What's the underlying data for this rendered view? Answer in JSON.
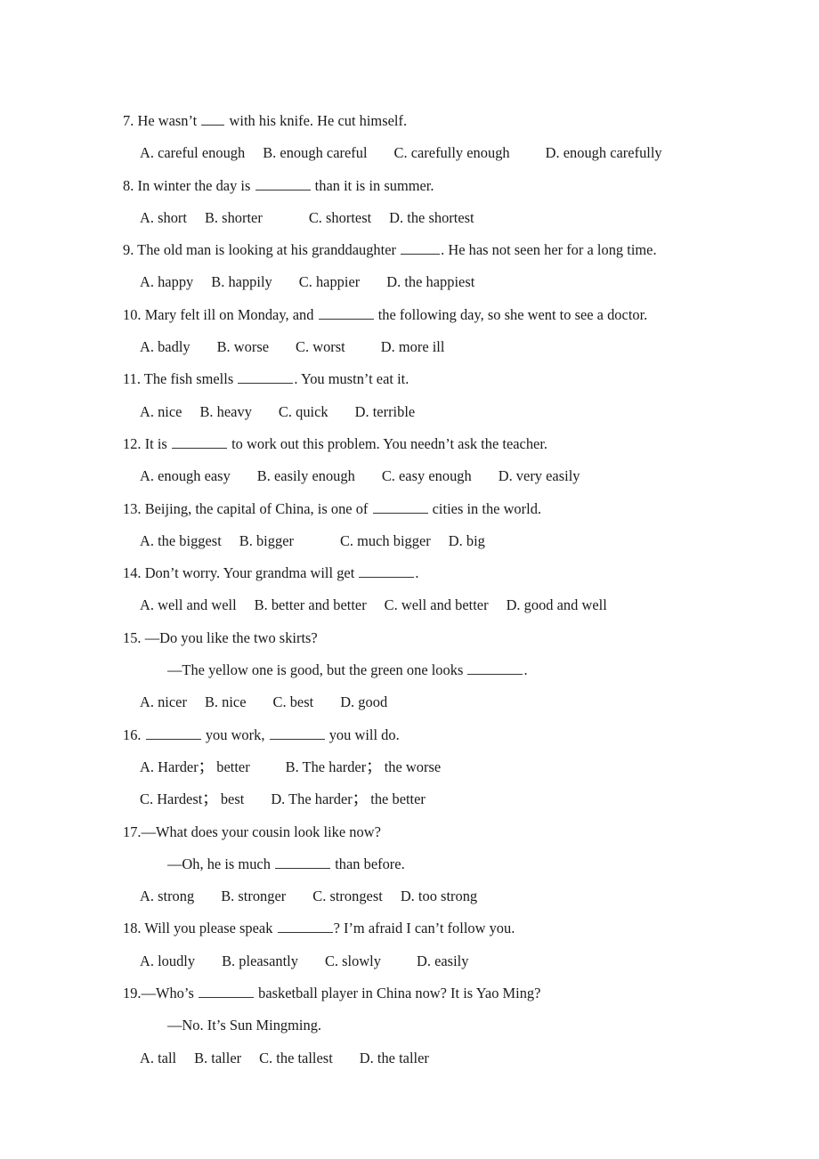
{
  "document": {
    "type": "worksheet",
    "subject": "English grammar multiple-choice exercise",
    "background_color": "#ffffff",
    "text_color": "#1a1a1a"
  },
  "questions": [
    {
      "number": "7.",
      "stem_before": "He wasn’t",
      "blank": "xs",
      "stem_after": "with his knife. He cut himself.",
      "options": [
        "A. careful enough",
        "B. enough careful",
        "C. carefully enough",
        "D. enough carefully"
      ]
    },
    {
      "number": "8.",
      "stem_before": "In winter the day is",
      "blank": "md",
      "stem_after": "than it is in summer.",
      "options": [
        "A. short",
        "B. shorter",
        "C. shortest",
        "D. the shortest"
      ]
    },
    {
      "number": "9.",
      "stem_before": "The old man is looking at his granddaughter",
      "blank": "sm",
      "stem_after": ". He has not seen her for a long time.",
      "options": [
        "A. happy",
        "B. happily",
        "C. happier",
        "D. the happiest"
      ]
    },
    {
      "number": "10.",
      "stem_before": "Mary felt ill on Monday, and",
      "blank": "md",
      "stem_after": "the following day, so she went to see a doctor.",
      "options": [
        "A. badly",
        "B. worse",
        "C. worst",
        "D. more ill"
      ]
    },
    {
      "number": "11.",
      "stem_before": "The fish smells",
      "blank": "md",
      "stem_after": ". You mustn’t eat it.",
      "options": [
        "A. nice",
        "B. heavy",
        "C. quick",
        "D. terrible"
      ]
    },
    {
      "number": "12.",
      "stem_before": "It is",
      "blank": "md",
      "stem_after": "to work out this problem. You needn’t ask the teacher.",
      "options": [
        "A. enough easy",
        "B. easily enough",
        "C. easy enough",
        "D. very easily"
      ]
    },
    {
      "number": "13.",
      "stem_before": "Beijing, the capital of China, is one of",
      "blank": "md",
      "stem_after": "cities in the world.",
      "options": [
        "A. the biggest",
        "B. bigger",
        "C. much bigger",
        "D. big"
      ]
    },
    {
      "number": "14.",
      "stem_before": "Don’t worry. Your grandma will get",
      "blank": "md",
      "stem_after": ".",
      "options": [
        "A. well and well",
        "B. better and better",
        "C. well and better",
        "D. good and well"
      ]
    },
    {
      "number": "15.",
      "stem_before": "—Do you like the two skirts?",
      "blank": "none",
      "stem_after": "",
      "reply_before": "—The yellow one is good, but the green one looks",
      "reply_blank": "md",
      "reply_after": ".",
      "options": [
        "A. nicer",
        "B. nice",
        "C. best",
        "D. good"
      ]
    },
    {
      "number": "16.",
      "stem_before": "",
      "blank": "md",
      "stem_mid": "you work,",
      "blank2": "md",
      "stem_after": "you will do.",
      "options_row1": [
        "A. Harder； better",
        "B. The harder； the worse"
      ],
      "options_row2": [
        "C. Hardest； best",
        "D. The harder； the better"
      ]
    },
    {
      "number": "17.",
      "stem_before": "—What does your cousin look like now?",
      "blank": "none",
      "stem_after": "",
      "reply_before": "—Oh, he is much",
      "reply_blank": "md",
      "reply_after": "than before.",
      "options": [
        "A. strong",
        "B. stronger",
        "C. strongest",
        "D. too strong"
      ]
    },
    {
      "number": "18.",
      "stem_before": "Will you please speak",
      "blank": "md",
      "stem_after": "? I’m afraid I can’t follow you.",
      "options": [
        "A. loudly",
        "B. pleasantly",
        "C. slowly",
        "D. easily"
      ]
    },
    {
      "number": "19.",
      "stem_before": "—Who’s",
      "blank": "md",
      "stem_after": "basketball player in China now? It is Yao Ming?",
      "reply_before": "—No. It’s Sun Mingming.",
      "reply_blank": "none",
      "reply_after": "",
      "options": [
        "A. tall",
        "B. taller",
        "C. the tallest",
        "D. the taller"
      ]
    }
  ]
}
